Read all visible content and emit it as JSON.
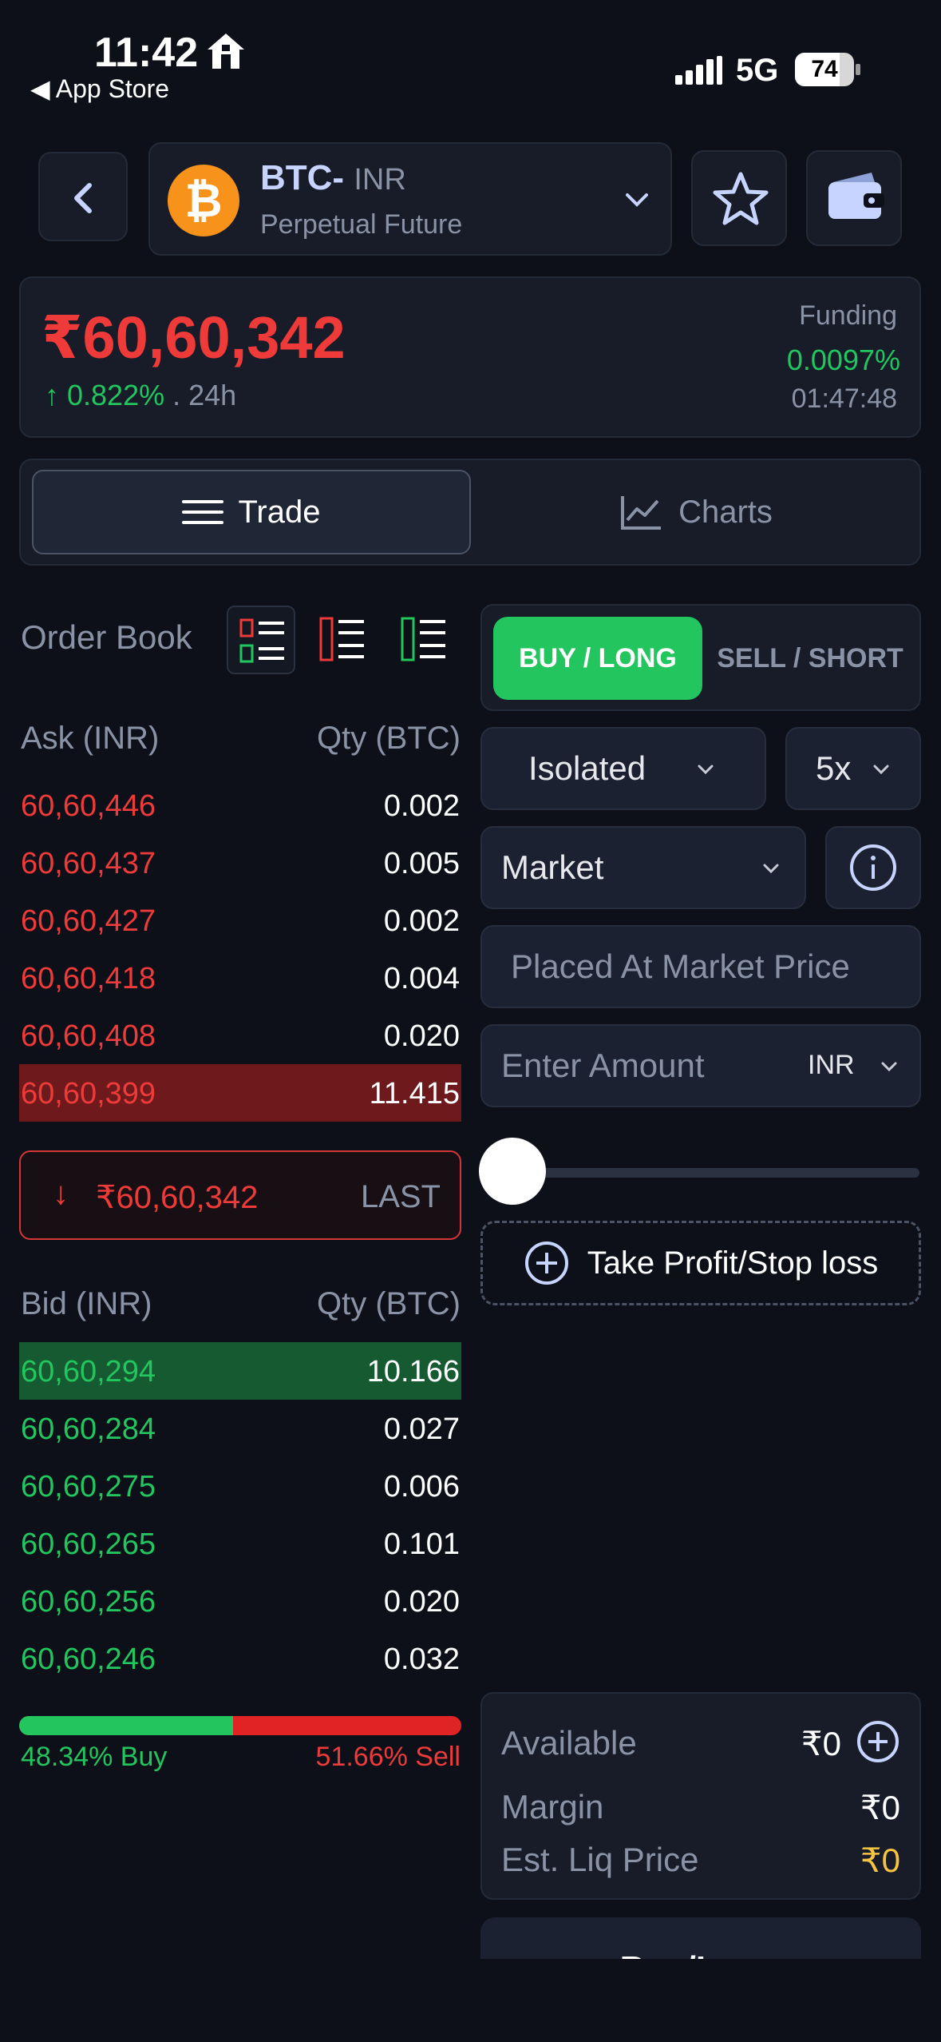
{
  "status_bar": {
    "time": "11:42",
    "back_label": "◀ App Store",
    "network": "5G",
    "battery": "74"
  },
  "header": {
    "pair_symbol": "BTC-",
    "pair_quote": "INR",
    "pair_subtitle": "Perpetual Future",
    "coin_glyph": "₿"
  },
  "ticker": {
    "price": "₹60,60,342",
    "change_arrow": "↑",
    "change": "0.822%",
    "change_suffix": " . 24h",
    "funding_label": "Funding",
    "funding_rate": "0.0097%",
    "funding_countdown": "01:47:48",
    "colors": {
      "down": "#ef3a3a",
      "up": "#22c55e"
    }
  },
  "tabs": {
    "trade": "Trade",
    "charts": "Charts",
    "active": "Trade"
  },
  "order_book": {
    "title": "Order Book",
    "ask_header": {
      "price": "Ask (INR)",
      "qty": "Qty (BTC)"
    },
    "asks": [
      {
        "price": "60,60,446",
        "qty": "0.002"
      },
      {
        "price": "60,60,437",
        "qty": "0.005"
      },
      {
        "price": "60,60,427",
        "qty": "0.002"
      },
      {
        "price": "60,60,418",
        "qty": "0.004"
      },
      {
        "price": "60,60,408",
        "qty": "0.020"
      },
      {
        "price": "60,60,399",
        "qty": "11.415"
      }
    ],
    "last": {
      "arrow": "↓",
      "price": "₹60,60,342",
      "label": "LAST"
    },
    "bid_header": {
      "price": "Bid (INR)",
      "qty": "Qty (BTC)"
    },
    "bids": [
      {
        "price": "60,60,294",
        "qty": "10.166"
      },
      {
        "price": "60,60,284",
        "qty": "0.027"
      },
      {
        "price": "60,60,275",
        "qty": "0.006"
      },
      {
        "price": "60,60,265",
        "qty": "0.101"
      },
      {
        "price": "60,60,256",
        "qty": "0.020"
      },
      {
        "price": "60,60,246",
        "qty": "0.032"
      }
    ],
    "buy_ratio": 0.4834,
    "buy_ratio_label": "48.34% Buy",
    "sell_ratio_label": "51.66% Sell"
  },
  "form": {
    "buy_label": "BUY / LONG",
    "sell_label": "SELL / SHORT",
    "margin_mode": "Isolated",
    "leverage": "5x",
    "order_type": "Market",
    "price_placeholder": "Placed At Market Price",
    "amount_placeholder": "Enter Amount",
    "amount_currency": "INR",
    "slider_value": 0,
    "tpsl_label": "Take Profit/Stop loss",
    "cta_label": "Buy/Long"
  },
  "summary": {
    "available_label": "Available",
    "available_value": "₹0",
    "margin_label": "Margin",
    "margin_value": "₹0",
    "liq_label": "Est. Liq Price",
    "liq_value": "₹0",
    "liq_color": "#f5c542"
  }
}
